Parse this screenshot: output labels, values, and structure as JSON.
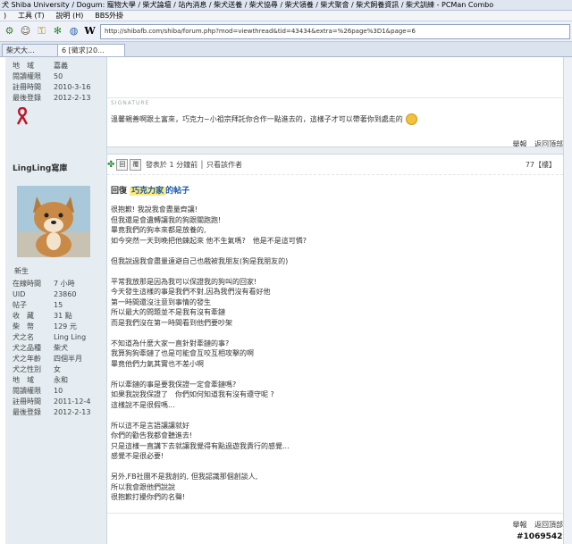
{
  "window": {
    "title": "犬 Shiba University / Dogum: 寵物大學 / 柴犬論壇 / 站內消息 / 柴犬送養 / 柴犬協尋 / 柴犬領養 / 柴犬聚會 / 柴犬飼養資訊 / 柴犬訓練 - PCMan Combo"
  },
  "menu": {
    "items": [
      ")",
      "工具 (T)",
      "說明 (H)",
      "BBS外掛"
    ]
  },
  "toolbar": {
    "url": "http://shibafb.com/shiba/forum.php?mod=viewthread&tid=43434&extra=%26page%3D1&page=6",
    "icons": [
      "gear-icon",
      "person-icon",
      "lock-icon",
      "puzzle-icon",
      "globe-icon",
      "wikipedia-icon"
    ]
  },
  "tabs": [
    {
      "label": "柴犬大..."
    },
    {
      "label": "6 [徵求]20..."
    }
  ],
  "prev_post": {
    "profile": [
      {
        "k": "地　域",
        "v": "嘉義"
      },
      {
        "k": "閱讀權限",
        "v": "50"
      },
      {
        "k": "註冊時間",
        "v": "2010-3-16"
      },
      {
        "k": "最後登錄",
        "v": "2012-2-13"
      }
    ],
    "signature_label": "SIGNATURE",
    "signature_text": "溫馨親善啊跟土富來，巧克力~小祖宗拜託你合作一點進去的，這樣子才可以帶著你到處走的",
    "report": "舉報",
    "back_top": "返回頂部"
  },
  "post": {
    "username": "LingLing寫庫",
    "rank": "新生",
    "profile": [
      {
        "k": "在線時間",
        "v": "7 小時"
      },
      {
        "k": "UID",
        "v": "23860"
      },
      {
        "k": "帖子",
        "v": "15"
      },
      {
        "k": "收　藏",
        "v": "31 點"
      },
      {
        "k": "柴　幣",
        "v": "129 元"
      },
      {
        "k": "犬之名",
        "v": "Ling Ling"
      },
      {
        "k": "犬之品種",
        "v": "柴犬"
      },
      {
        "k": "犬之年齡",
        "v": "四個半月"
      },
      {
        "k": "犬之性別",
        "v": "女"
      },
      {
        "k": "地　域",
        "v": "永和"
      },
      {
        "k": "閱讀權限",
        "v": "10"
      },
      {
        "k": "註冊時間",
        "v": "2011-12-4"
      },
      {
        "k": "最後登錄",
        "v": "2012-2-13"
      }
    ],
    "meta": "發表於 1 分鐘前 │ 只看該作者",
    "btn1": "回",
    "btn2": "覆",
    "floor": "77【樓】",
    "quote_prefix": "回復",
    "quote_user": "巧克力家",
    "quote_suffix": "的帖子",
    "lines": [
      "很抱歉! 我說我會盡量齊讓!",
      "但我還是會遺轉讓我的狗跟關跑跑!",
      "畢竟我們的狗本來都是放養的,",
      "如今突然一天到晚把他鍊起來 他不生氣嗎?　他是不是這可憐?",
      "",
      "但我說過我會盡量遠避自己也戲被我朋友(狗是我朋友的)",
      "",
      "平常我放那是因為我可以保證我的狗叫的回家!",
      "今天發生這樣的事是我們不對,因為我們沒有看好他",
      "第一時間還沒注意到事情的發生",
      "所以最大的問題並不是我有沒有牽鏈",
      "而是我們沒在第一時間看到他們要吵架",
      "",
      "不知道為什麼大家一直針對牽鏈的事?",
      "我算狗狗牽鏈了也是可能會互咬互相攻擊的啊",
      "畢竟他們力氣其實也不差小啊",
      "",
      "所以牽鏈的事是要我保證一定會牽鏈嗎?",
      "如果我說我保證了　你們如何知道我有沒有遵守呢 ?",
      "這樣說不是很假嗎...",
      "",
      "所以這不是言語讓讓就好",
      "你們的勸告我都會聽進去!",
      "只是這樣一直講下去就讓我覺得有點過遊我責行的感覺...",
      "感覺不是很必要!",
      "",
      "另外,FB社團不是我創的, 但我認識那個創談人,",
      "所以我會跟他們說說",
      "很抱歉打擾你們的名聲!"
    ],
    "report": "舉報",
    "back_top": "返回頂部"
  },
  "watermark": "#1069542"
}
